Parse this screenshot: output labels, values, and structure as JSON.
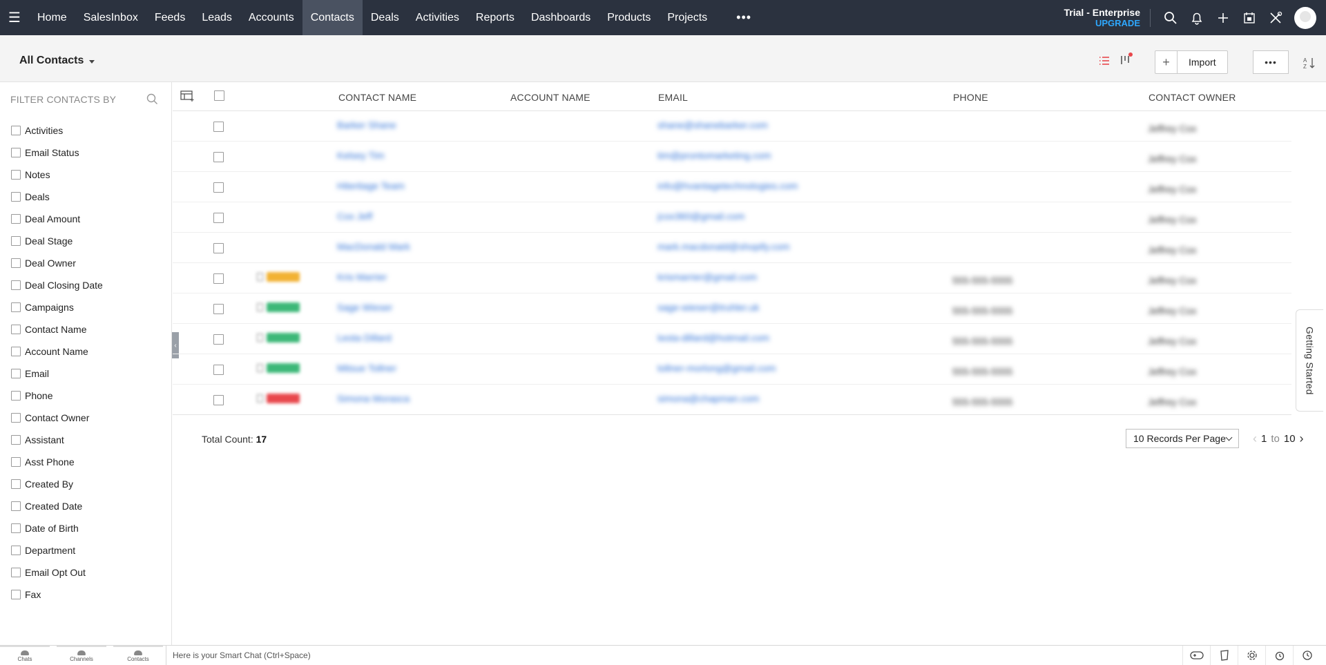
{
  "nav": {
    "items": [
      "Home",
      "SalesInbox",
      "Feeds",
      "Leads",
      "Accounts",
      "Contacts",
      "Deals",
      "Activities",
      "Reports",
      "Dashboards",
      "Products",
      "Projects"
    ],
    "active": "Contacts",
    "more": "•••",
    "trial_label": "Trial - Enterprise",
    "upgrade_label": "UPGRADE"
  },
  "header": {
    "view_name": "All Contacts",
    "import_label": "Import",
    "plus_label": "+",
    "more_label": "•••"
  },
  "sidebar": {
    "title": "FILTER CONTACTS BY",
    "filters": [
      "Activities",
      "Email Status",
      "Notes",
      "Deals",
      "Deal Amount",
      "Deal Stage",
      "Deal Owner",
      "Deal Closing Date",
      "Campaigns",
      "Contact Name",
      "Account Name",
      "Email",
      "Phone",
      "Contact Owner",
      "Assistant",
      "Asst Phone",
      "Created By",
      "Created Date",
      "Date of Birth",
      "Department",
      "Email Opt Out",
      "Fax"
    ]
  },
  "table": {
    "columns": {
      "contact_name": "CONTACT NAME",
      "account_name": "ACCOUNT NAME",
      "email": "EMAIL",
      "phone": "PHONE",
      "owner": "CONTACT OWNER"
    },
    "rows": [
      {
        "name": "Barker Shane",
        "email": "shane@shanebarker.com",
        "phone": "",
        "owner": "Jeffrey Cox",
        "tag": ""
      },
      {
        "name": "Kelsey Tim",
        "email": "tim@prontomarketing.com",
        "phone": "",
        "owner": "Jeffrey Cox",
        "tag": ""
      },
      {
        "name": "Hiteritage Team",
        "email": "info@hvantagetechnologies.com",
        "phone": "",
        "owner": "Jeffrey Cox",
        "tag": ""
      },
      {
        "name": "Cox Jeff",
        "email": "jcox360@gmail.com",
        "phone": "",
        "owner": "Jeffrey Cox",
        "tag": ""
      },
      {
        "name": "MacDonald Mark",
        "email": "mark.macdonald@shopify.com",
        "phone": "",
        "owner": "Jeffrey Cox",
        "tag": ""
      },
      {
        "name": "Kris Marrier",
        "email": "krismarrier@gmail.com",
        "phone": "555-555-5555",
        "owner": "Jeffrey Cox",
        "tag": "#f2b233"
      },
      {
        "name": "Sage Wieser",
        "email": "sage-wieser@truhler.uk",
        "phone": "555-555-5555",
        "owner": "Jeffrey Cox",
        "tag": "#3cb878"
      },
      {
        "name": "Leota Dillard",
        "email": "leota-dillard@hotmail.com",
        "phone": "555-555-5555",
        "owner": "Jeffrey Cox",
        "tag": "#3cb878"
      },
      {
        "name": "Mitsue Tollner",
        "email": "tollner-morlong@gmail.com",
        "phone": "555-555-5555",
        "owner": "Jeffrey Cox",
        "tag": "#3cb878"
      },
      {
        "name": "Simona Morasca",
        "email": "simona@chapman.com",
        "phone": "555-555-5555",
        "owner": "Jeffrey Cox",
        "tag": "#e8474c"
      }
    ]
  },
  "footer": {
    "total_label": "Total Count: ",
    "total_value": "17",
    "per_page": "10 Records Per Page",
    "page_from": "1",
    "page_to_label": "to",
    "page_to": "10"
  },
  "getting_started": "Getting Started",
  "bottombar": {
    "tabs": [
      "Chats",
      "Channels",
      "Contacts"
    ],
    "smartchat_placeholder": "Here is your Smart Chat (Ctrl+Space)"
  },
  "colors": {
    "topnav_bg": "#2b323f",
    "accent": "#2ea8ff",
    "link": "#2b6fd6"
  }
}
